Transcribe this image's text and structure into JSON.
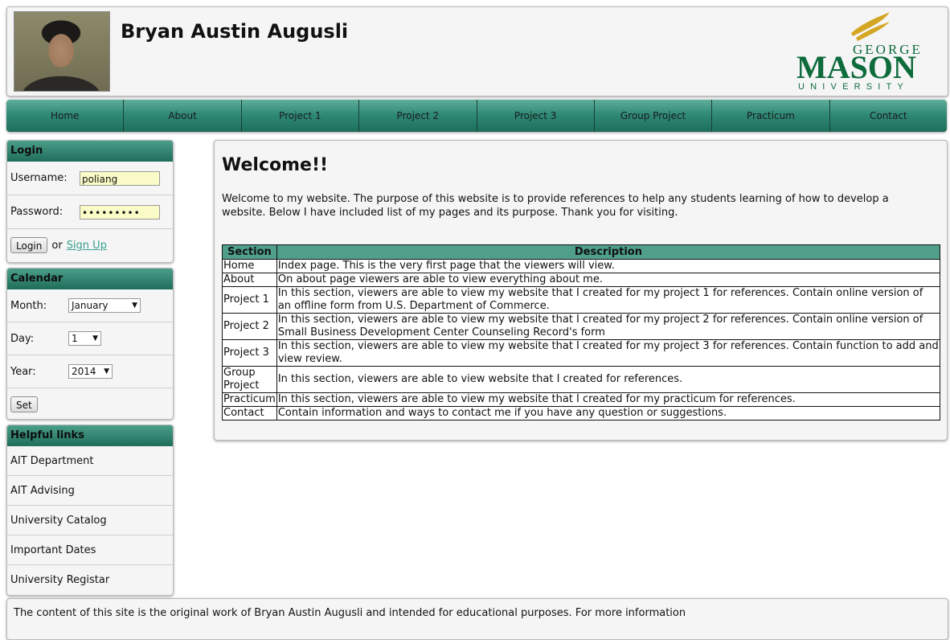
{
  "header": {
    "name": "Bryan Austin Augusli",
    "logo_line1": "GEORGE",
    "logo_line2": "MASON",
    "logo_line3": "UNIVERSITY"
  },
  "nav": [
    "Home",
    "About",
    "Project 1",
    "Project 2",
    "Project 3",
    "Group Project",
    "Practicum",
    "Contact"
  ],
  "login": {
    "title": "Login",
    "username_label": "Username:",
    "username_value": "poliang",
    "password_label": "Password:",
    "password_value": "•••••••••",
    "login_button": "Login",
    "or_text": "or",
    "signup_link": "Sign Up"
  },
  "calendar": {
    "title": "Calendar",
    "month_label": "Month:",
    "month_value": "January",
    "day_label": "Day:",
    "day_value": "1",
    "year_label": "Year:",
    "year_value": "2014",
    "set_button": "Set"
  },
  "links": {
    "title": "Helpful links",
    "items": [
      "AIT Department",
      "AIT Advising",
      "University Catalog",
      "Important Dates",
      "University Registar"
    ]
  },
  "main": {
    "title": "Welcome!!",
    "intro": "Welcome to my website. The purpose of this website is to provide references to help any students learning of how to develop a website. Below I have included list of my pages and its purpose. Thank you for visiting.",
    "table_headers": [
      "Section",
      "Description"
    ],
    "rows": [
      {
        "section": "Home",
        "description": "Index page. This is the very first page that the viewers will view."
      },
      {
        "section": "About",
        "description": "On about page viewers are able to view everything about me."
      },
      {
        "section": "Project 1",
        "description": "In this section, viewers are able to view my website that I created for my project 1 for references. Contain online version of an offline form from U.S. Department of Commerce."
      },
      {
        "section": "Project 2",
        "description": "In this section, viewers are able to view my website that I created for my project 2 for references. Contain online version of Small Business Development Center Counseling Record's form"
      },
      {
        "section": "Project 3",
        "description": "In this section, viewers are able to view my website that I created for my project 3 for references. Contain function to add and view review."
      },
      {
        "section": "Group Project",
        "description": "In this section, viewers are able to view website that I created for references."
      },
      {
        "section": "Practicum",
        "description": "In this section, viewers are able to view my website that I created for my practicum for references."
      },
      {
        "section": "Contact",
        "description": "Contain information and ways to contact me if you have any question or suggestions."
      }
    ]
  },
  "footer": {
    "text": "The content of this site is the original work of Bryan Austin Augusli and intended for educational purposes. For more information"
  },
  "colors": {
    "accent": "#2f8a76",
    "table_header": "#4f9f8b",
    "input_bg": "#fbfbc8",
    "link": "#3aa090",
    "logo_green": "#0d6b3c",
    "logo_gold": "#d4a624"
  }
}
